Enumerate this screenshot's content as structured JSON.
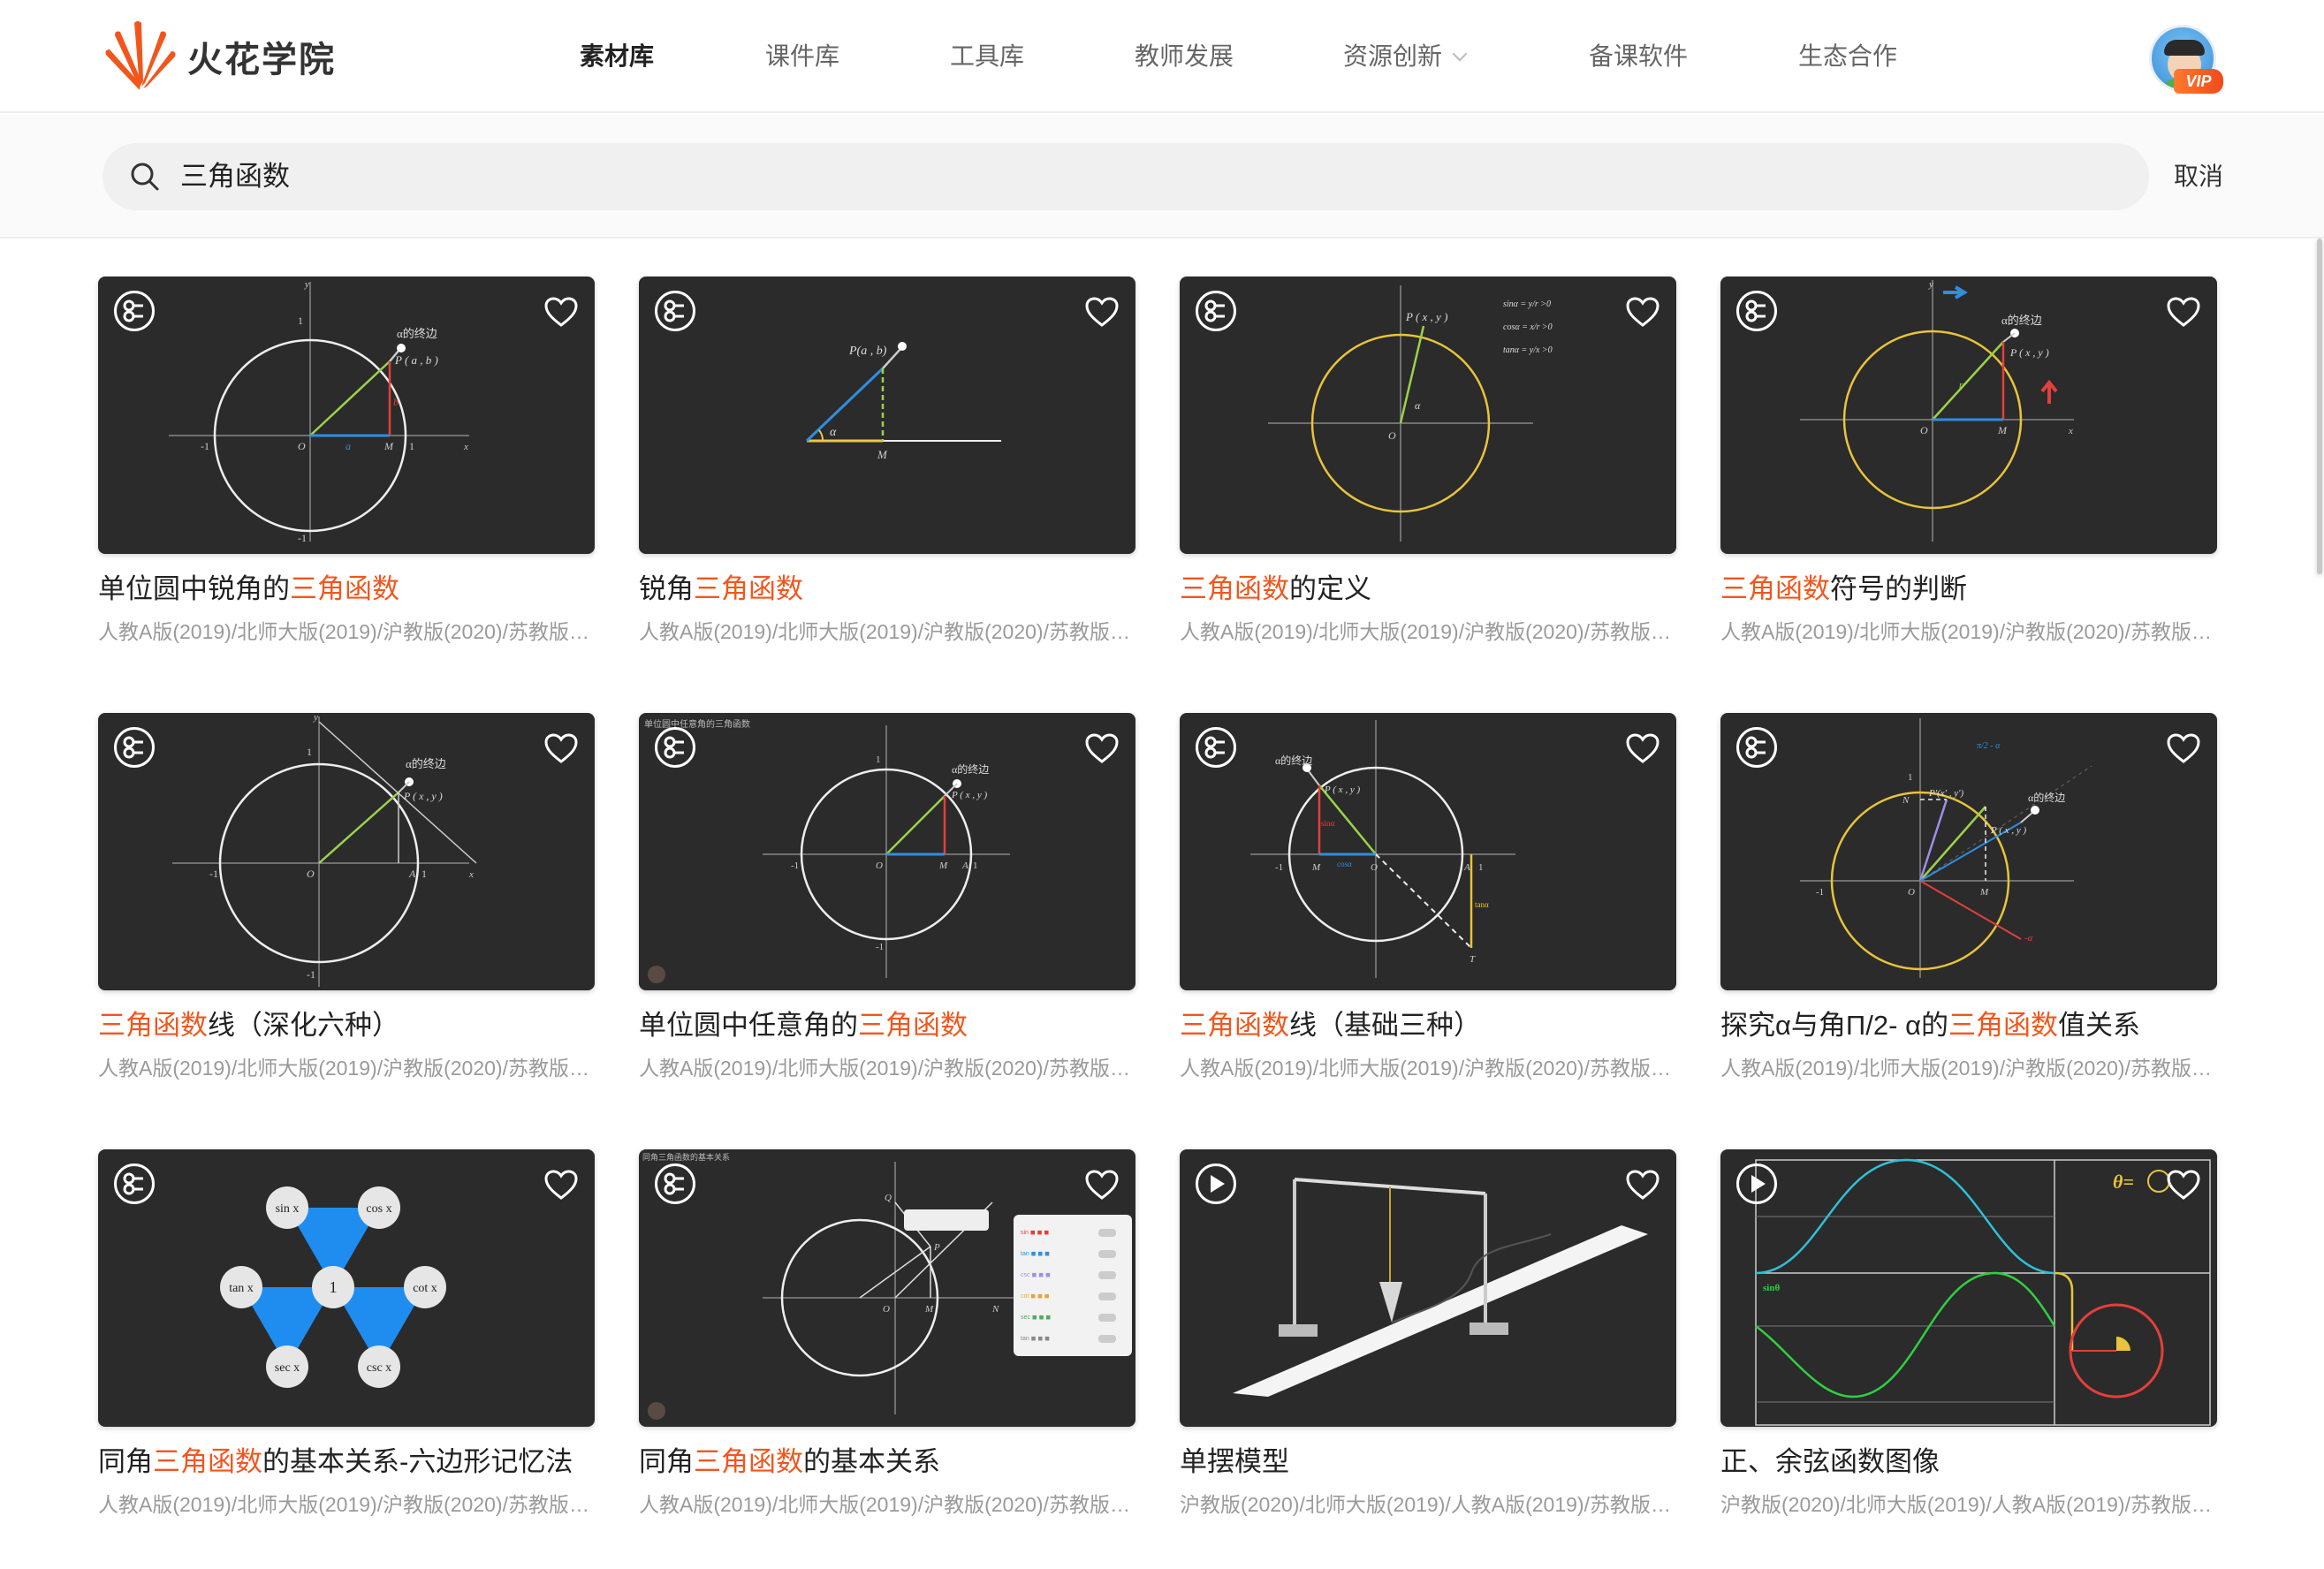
{
  "brand": {
    "name": "火花学院"
  },
  "nav": [
    {
      "label": "素材库",
      "active": true
    },
    {
      "label": "课件库"
    },
    {
      "label": "工具库"
    },
    {
      "label": "教师发展"
    },
    {
      "label": "资源创新",
      "dropdown": true
    },
    {
      "label": "备课软件"
    },
    {
      "label": "生态合作"
    }
  ],
  "user": {
    "badge": "VIP"
  },
  "search": {
    "query": "三角函数",
    "cancel_label": "取消"
  },
  "colors": {
    "accent": "#f2561d",
    "thumb_bg": "#2b2b2b"
  },
  "cards": [
    {
      "pre": "单位圆中锐角的",
      "hl": "三角函数",
      "post": "",
      "sub": "人教A版(2019)/北师大版(2019)/沪教版(2020)/苏教版(2019)",
      "type": "interactive-icon",
      "labels": [
        "α的终边",
        "P ( a , b )",
        "1",
        "-1",
        "O",
        "a",
        "b",
        "M",
        "1",
        "-1",
        "x",
        "y"
      ]
    },
    {
      "pre": "锐角",
      "hl": "三角函数",
      "post": "",
      "sub": "人教A版(2019)/北师大版(2019)/沪教版(2020)/苏教版(2019)",
      "type": "interactive-icon",
      "labels": [
        "P(a , b)",
        "α",
        "M"
      ]
    },
    {
      "pre": "",
      "hl": "三角函数",
      "post": "的定义",
      "sub": "人教A版(2019)/北师大版(2019)/沪教版(2020)/苏教版(2019)",
      "type": "interactive-icon",
      "labels": [
        "P ( x , y )",
        "α",
        "O",
        "sinα = y/r >0",
        "cosα = x/r >0",
        "tanα = y/x >0"
      ]
    },
    {
      "pre": "",
      "hl": "三角函数",
      "post": "符号的判断",
      "sub": "人教A版(2019)/北师大版(2019)/沪教版(2020)/苏教版(2019)",
      "type": "interactive-icon",
      "labels": [
        "α的终边",
        "P ( x , y )",
        "O",
        "M",
        "x",
        "y",
        "r"
      ]
    },
    {
      "pre": "",
      "hl": "三角函数",
      "post": "线（深化六种）",
      "sub": "人教A版(2019)/北师大版(2019)/沪教版(2020)/苏教版(2019)",
      "type": "interactive-icon",
      "labels": [
        "α的终边",
        "P ( x , y )",
        "1",
        "-1",
        "O",
        "A",
        "1",
        "-1",
        "x",
        "y"
      ]
    },
    {
      "pre": "单位圆中任意角的",
      "hl": "三角函数",
      "post": "",
      "sub": "人教A版(2019)/北师大版(2019)/沪教版(2020)/苏教版(2019)",
      "type": "interactive-icon",
      "labels": [
        "单位圆中任意角的三角函数",
        "α的终边",
        "P ( x , y )",
        "1",
        "-1",
        "O",
        "M",
        "A",
        "1",
        "-1"
      ]
    },
    {
      "pre": "",
      "hl": "三角函数",
      "post": "线（基础三种）",
      "sub": "人教A版(2019)/北师大版(2019)/沪教版(2020)/苏教版(2019)",
      "type": "interactive-icon",
      "labels": [
        "α的终边",
        "P ( x , y )",
        "sinα",
        "cosα",
        "tanα",
        "O",
        "M",
        "A",
        "T",
        "1",
        "-1"
      ]
    },
    {
      "pre": "探究α与角Π/2- α的",
      "hl": "三角函数",
      "post": "值关系",
      "sub": "人教A版(2019)/北师大版(2019)/沪教版(2020)/苏教版(2019)",
      "type": "interactive-icon",
      "labels": [
        "π/2 - α",
        "α的终边",
        "P'(x' , y')",
        "P ( x , y )",
        "N",
        "M",
        "O",
        "1",
        "-1",
        "-α"
      ]
    },
    {
      "pre": "同角",
      "hl": "三角函数",
      "post": "的基本关系-六边形记忆法",
      "sub": "人教A版(2019)/北师大版(2019)/沪教版(2020)/苏教版(2019)",
      "type": "interactive-icon",
      "labels": [
        "sin x",
        "cos x",
        "tan x",
        "1",
        "cot x",
        "sec x",
        "csc x"
      ]
    },
    {
      "pre": "同角",
      "hl": "三角函数",
      "post": "的基本关系",
      "sub": "人教A版(2019)/北师大版(2019)/沪教版(2020)/苏教版(2019)",
      "type": "interactive-icon",
      "labels": [
        "同角三角函数的基本关系",
        "Q",
        "P",
        "O",
        "M",
        "N"
      ]
    },
    {
      "pre": "单摆模型",
      "hl": "",
      "post": "",
      "sub": "沪教版(2020)/北师大版(2019)/人教A版(2019)/苏教版(2019)",
      "type": "video-icon",
      "labels": []
    },
    {
      "pre": "正、余弦函数图像",
      "hl": "",
      "post": "",
      "sub": "沪教版(2020)/北师大版(2019)/人教A版(2019)/苏教版(2019)",
      "type": "video-icon",
      "labels": [
        "sinθ",
        "θ="
      ]
    }
  ]
}
